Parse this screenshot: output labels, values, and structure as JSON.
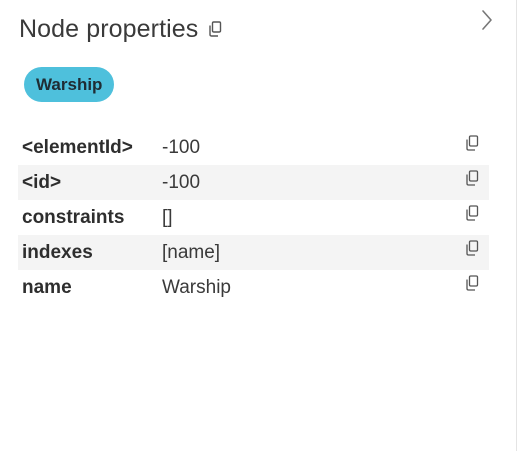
{
  "panel": {
    "title": "Node properties",
    "title_copy_icon": "copy-icon",
    "collapse_icon": "chevron-right-icon"
  },
  "labels": [
    {
      "text": "Warship",
      "color": "#4ec0dc"
    }
  ],
  "properties": [
    {
      "key": "<elementId>",
      "value": "-100"
    },
    {
      "key": "<id>",
      "value": "-100"
    },
    {
      "key": "constraints",
      "value": "[]"
    },
    {
      "key": "indexes",
      "value": "[name]"
    },
    {
      "key": "name",
      "value": "Warship"
    }
  ]
}
